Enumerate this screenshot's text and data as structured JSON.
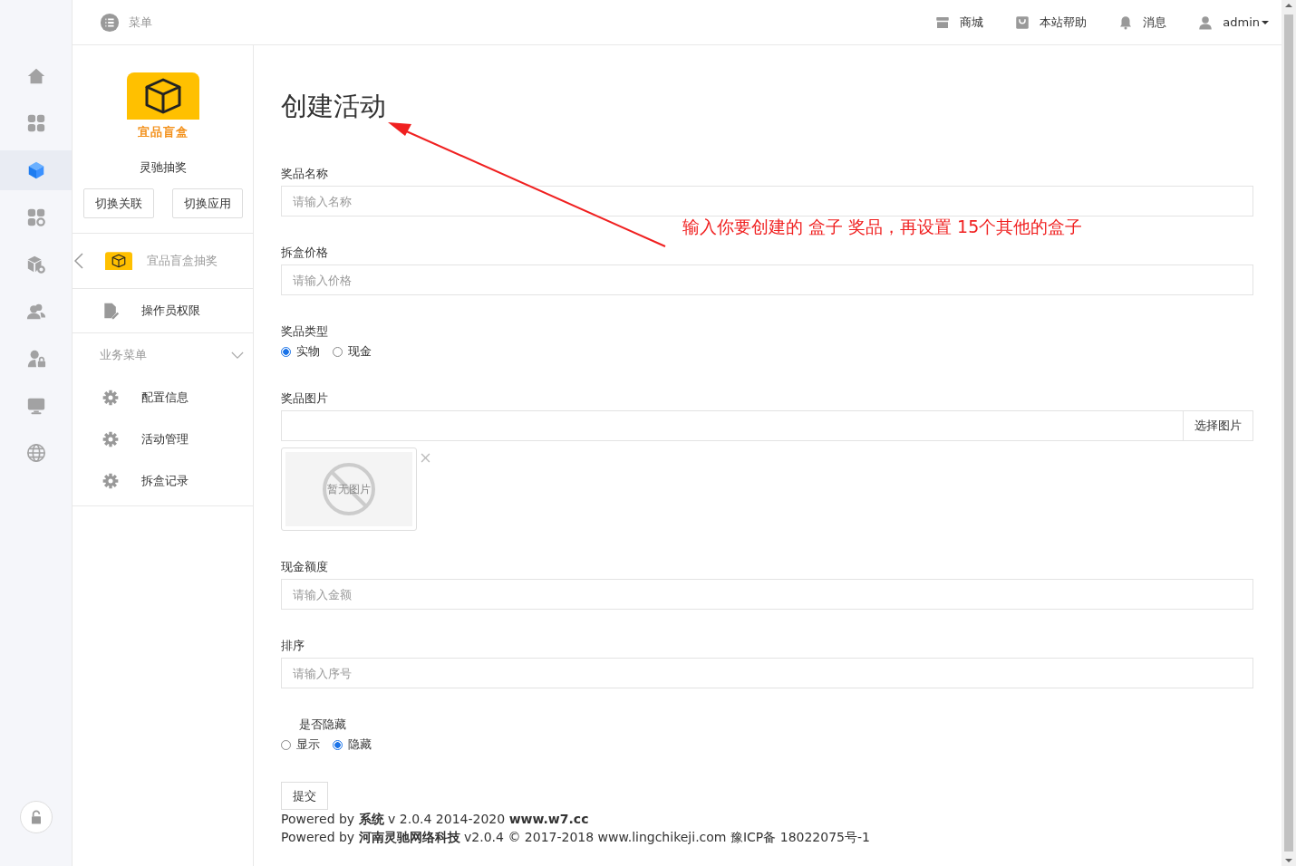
{
  "top_bar": {
    "menu_label": "菜单",
    "links": [
      {
        "label": "商城"
      },
      {
        "label": "本站帮助"
      },
      {
        "label": "消息"
      }
    ],
    "user": "admin"
  },
  "rail": [
    {
      "selected": false
    },
    {
      "selected": false
    },
    {
      "selected": true
    },
    {
      "selected": false
    },
    {
      "selected": false
    },
    {
      "selected": false
    },
    {
      "selected": false
    },
    {
      "selected": false
    },
    {
      "selected": false
    }
  ],
  "app_panel": {
    "logo_text": "宜品盲盒",
    "name": "灵驰抽奖",
    "buttons": [
      "切换关联",
      "切换应用"
    ]
  },
  "module": {
    "label": "宜品盲盒抽奖"
  },
  "menu": [
    {
      "label": "操作员权限"
    }
  ],
  "section": {
    "title": "业务菜单",
    "expanded": true,
    "items": [
      {
        "label": "配置信息"
      },
      {
        "label": "活动管理"
      },
      {
        "label": "拆盒记录"
      }
    ]
  },
  "page_title": "创建活动",
  "annotation": "输入你要创建的 盒子 奖品，再设置 15个其他的盒子",
  "form": [
    {
      "kind": "text",
      "label": "奖品名称",
      "placeholder": "请输入名称"
    },
    {
      "kind": "text",
      "label": "拆盒价格",
      "placeholder": "请输入价格"
    },
    {
      "kind": "radio",
      "label": "奖品类型",
      "options": [
        {
          "label": "实物",
          "selected": true
        },
        {
          "label": "现金",
          "selected": false
        }
      ]
    },
    {
      "kind": "image",
      "label": "奖品图片",
      "button": "选择图片",
      "placeholder_text": "暂无图片"
    },
    {
      "kind": "text",
      "label": "现金额度",
      "placeholder": "请输入金额"
    },
    {
      "kind": "text",
      "label": "排序",
      "placeholder": "请输入序号"
    },
    {
      "kind": "radio",
      "label": "是否隐藏",
      "indent": true,
      "options": [
        {
          "label": "显示",
          "selected": false
        },
        {
          "label": "隐藏",
          "selected": true
        }
      ]
    }
  ],
  "submit": "提交",
  "footer": [
    "Powered by **系统** v 2.0.4 2014-2020 **www.w7.cc**",
    "Powered by **河南灵驰网络科技** v2.0.4 © 2017-2018 www.lingchikeji.com 豫ICP备 18022075号-1"
  ]
}
